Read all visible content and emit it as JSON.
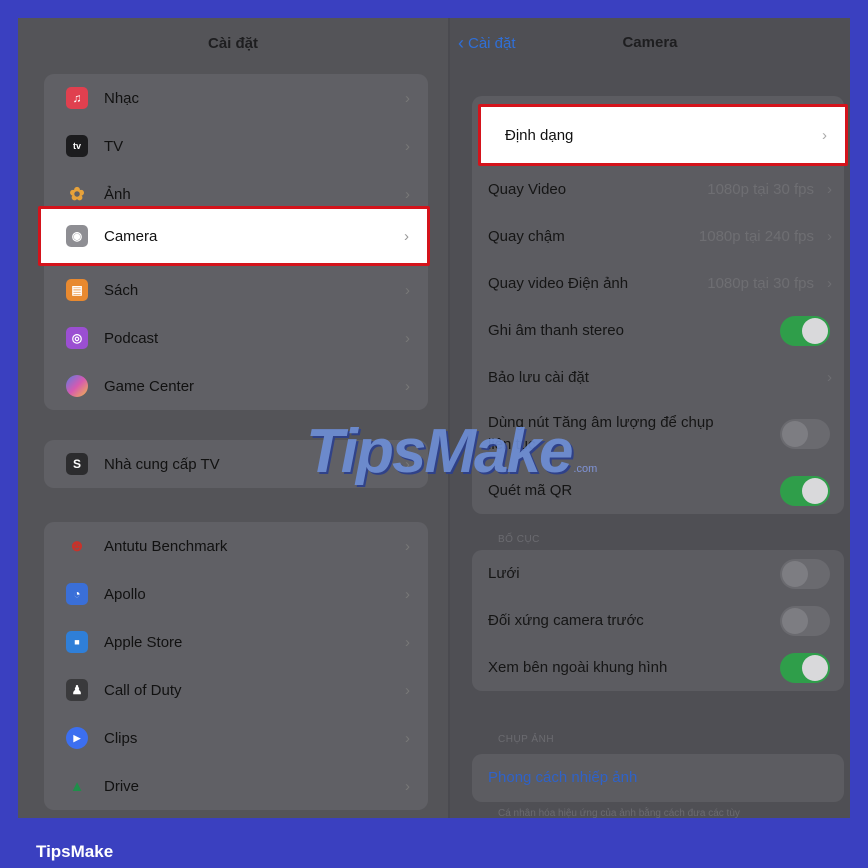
{
  "left": {
    "title": "Cài đặt",
    "group1": [
      {
        "label": "Nhạc",
        "icon": "music-icon",
        "color": "#e0404f",
        "glyph": "♫"
      },
      {
        "label": "TV",
        "icon": "appletv-icon",
        "color": "#222222",
        "glyph": "tv"
      },
      {
        "label": "Ảnh",
        "icon": "photos-icon",
        "color": "#e7a23a",
        "glyph": "✿"
      },
      {
        "label": "Camera",
        "icon": "camera-icon",
        "color": "#8e8e93",
        "glyph": "◉"
      },
      {
        "label": "Sách",
        "icon": "books-icon",
        "color": "#e8892f",
        "glyph": "▤"
      },
      {
        "label": "Podcast",
        "icon": "podcast-icon",
        "color": "#9b4fd2",
        "glyph": "◎"
      },
      {
        "label": "Game Center",
        "icon": "gamecenter-icon",
        "color": "#6a7bd8",
        "glyph": "●"
      }
    ],
    "group2": [
      {
        "label": "Nhà cung cấp TV",
        "icon": "tvprovider-icon",
        "color": "#2c2c2e",
        "glyph": "S"
      }
    ],
    "group3": [
      {
        "label": "Antutu Benchmark",
        "icon": "antutu-icon",
        "color": "#c8322a",
        "glyph": "☻"
      },
      {
        "label": "Apollo",
        "icon": "apollo-icon",
        "color": "#3a6fd8",
        "glyph": "◔"
      },
      {
        "label": "Apple Store",
        "icon": "applestore-icon",
        "color": "#2f7fd8",
        "glyph": "■"
      },
      {
        "label": "Call of Duty",
        "icon": "callofduty-icon",
        "color": "#3a3a3c",
        "glyph": "♟"
      },
      {
        "label": "Clips",
        "icon": "clips-icon",
        "color": "#3c6ff0",
        "glyph": "▶"
      },
      {
        "label": "Drive",
        "icon": "drive-icon",
        "color": "#f0f0f0",
        "glyph": "▲"
      }
    ]
  },
  "right": {
    "back_label": "Cài đặt",
    "title": "Camera",
    "format_label": "Định dạng",
    "rows1": [
      {
        "label": "Quay Video",
        "value": "1080p tại 30 fps"
      },
      {
        "label": "Quay chậm",
        "value": "1080p tại 240 fps"
      },
      {
        "label": "Quay video Điện ảnh",
        "value": "1080p tại 30 fps"
      }
    ],
    "stereo_label": "Ghi âm thanh stereo",
    "preserve_label": "Bảo lưu cài đặt",
    "volume_label_line1": "Dùng nút Tăng âm lượng để chụp",
    "volume_label_line2": "liên tục",
    "qr_label": "Quét mã QR",
    "section_layout": "BỐ CỤC",
    "grid_label": "Lưới",
    "mirror_label": "Đối xứng camera trước",
    "outside_label": "Xem bên ngoài khung hình",
    "section_photo": "CHỤP ẢNH",
    "photo_style_label": "Phong cách nhiếp ảnh",
    "footnote": "Cá nhân hóa hiệu ứng của ảnh bằng cách đưa các tùy"
  },
  "watermark": {
    "main": "TipsMake",
    "suffix": ".com"
  },
  "brand": "TipsMake"
}
